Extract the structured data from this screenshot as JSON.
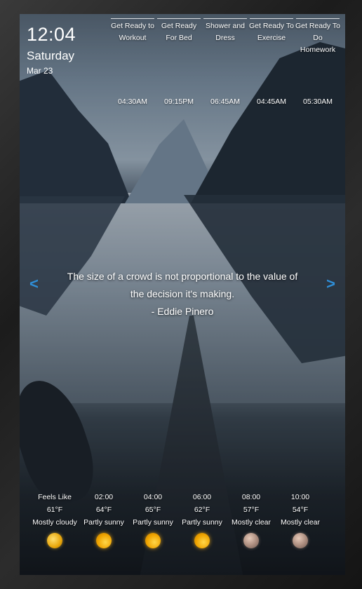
{
  "clock": {
    "time": "12:04",
    "day": "Saturday",
    "date": "Mar 23"
  },
  "schedule": [
    {
      "label": "Get Ready to Workout",
      "time": "04:30AM"
    },
    {
      "label": "Get Ready For Bed",
      "time": "09:15PM"
    },
    {
      "label": "Shower and Dress",
      "time": "06:45AM"
    },
    {
      "label": "Get Ready To Exercise",
      "time": "04:45AM"
    },
    {
      "label": "Get Ready To Do Homework",
      "time": "05:30AM"
    }
  ],
  "quote": {
    "text": "The size of a crowd is not proportional to the value of the decision it's making.",
    "author": "- Eddie Pinero",
    "prev_icon": "chevron-left",
    "next_icon": "chevron-right",
    "arrow_color": "#2f8fd8"
  },
  "weather": [
    {
      "time": "Feels Like",
      "temp": "61°F",
      "condition": "Mostly cloudy",
      "icon": "sun-icon"
    },
    {
      "time": "02:00",
      "temp": "64°F",
      "condition": "Partly sunny",
      "icon": "partly-sunny-icon"
    },
    {
      "time": "04:00",
      "temp": "65°F",
      "condition": "Partly sunny",
      "icon": "partly-sunny-icon"
    },
    {
      "time": "06:00",
      "temp": "62°F",
      "condition": "Partly sunny",
      "icon": "partly-sunny-icon"
    },
    {
      "time": "08:00",
      "temp": "57°F",
      "condition": "Mostly clear",
      "icon": "moon-icon"
    },
    {
      "time": "10:00",
      "temp": "54°F",
      "condition": "Mostly clear",
      "icon": "moon-icon"
    }
  ]
}
